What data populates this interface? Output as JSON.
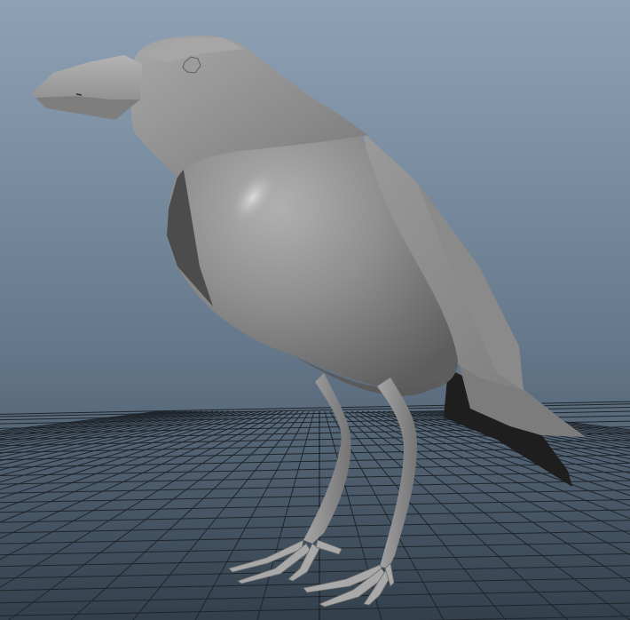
{
  "viewport": {
    "kind": "3d-modeling-perspective-viewport",
    "background_top_color": "#8fa2b5",
    "background_bottom_color": "#33404c",
    "grid_visible": true,
    "grid_line_color": "#1f252b",
    "grid_axis_color": "#15191d"
  },
  "model": {
    "subject": "crow",
    "shading": "smooth-shaded",
    "material_color": "#8e8e8e",
    "highlight_color": "#c4c4c4",
    "shadow_color": "#3c3c3c"
  }
}
